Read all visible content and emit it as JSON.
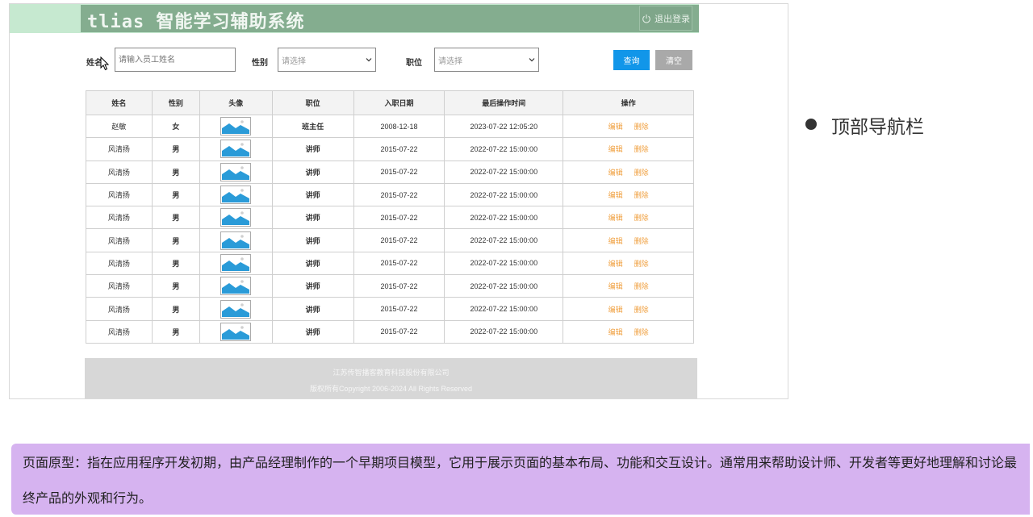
{
  "header": {
    "brand": "tlias 智能学习辅助系统",
    "logout_label": "退出登录"
  },
  "filters": {
    "name_label": "姓名",
    "name_placeholder": "请输入员工姓名",
    "gender_label": "性别",
    "gender_value": "请选择",
    "job_label": "职位",
    "job_value": "请选择",
    "query_label": "查询",
    "clear_label": "清空"
  },
  "table": {
    "columns": [
      "姓名",
      "性别",
      "头像",
      "职位",
      "入职日期",
      "最后操作时间",
      "操作"
    ],
    "edit_label": "编辑",
    "delete_label": "删除",
    "rows": [
      {
        "name": "赵敏",
        "gender": "女",
        "job": "班主任",
        "entry_date": "2008-12-18",
        "update_time": "2023-07-22 12:05:20"
      },
      {
        "name": "风清扬",
        "gender": "男",
        "job": "讲师",
        "entry_date": "2015-07-22",
        "update_time": "2022-07-22 15:00:00"
      },
      {
        "name": "风清扬",
        "gender": "男",
        "job": "讲师",
        "entry_date": "2015-07-22",
        "update_time": "2022-07-22 15:00:00"
      },
      {
        "name": "风清扬",
        "gender": "男",
        "job": "讲师",
        "entry_date": "2015-07-22",
        "update_time": "2022-07-22 15:00:00"
      },
      {
        "name": "风清扬",
        "gender": "男",
        "job": "讲师",
        "entry_date": "2015-07-22",
        "update_time": "2022-07-22 15:00:00"
      },
      {
        "name": "风清扬",
        "gender": "男",
        "job": "讲师",
        "entry_date": "2015-07-22",
        "update_time": "2022-07-22 15:00:00"
      },
      {
        "name": "风清扬",
        "gender": "男",
        "job": "讲师",
        "entry_date": "2015-07-22",
        "update_time": "2022-07-22 15:00:00"
      },
      {
        "name": "风清扬",
        "gender": "男",
        "job": "讲师",
        "entry_date": "2015-07-22",
        "update_time": "2022-07-22 15:00:00"
      },
      {
        "name": "风清扬",
        "gender": "男",
        "job": "讲师",
        "entry_date": "2015-07-22",
        "update_time": "2022-07-22 15:00:00"
      },
      {
        "name": "风清扬",
        "gender": "男",
        "job": "讲师",
        "entry_date": "2015-07-22",
        "update_time": "2022-07-22 15:00:00"
      }
    ]
  },
  "footer": {
    "company": "江苏传智播客教育科技股份有限公司",
    "copyright": "版权所有Copyright 2006-2024  All Rights Reserved"
  },
  "side": {
    "bullet_text": "顶部导航栏"
  },
  "note": {
    "text": "页面原型：指在应用程序开发初期，由产品经理制作的一个早期项目模型，它用于展示页面的基本布局、功能和交互设计。通常用来帮助设计师、开发者等更好地理解和讨论最终产品的外观和行为。"
  },
  "colors": {
    "header_bg": "#84ad8f",
    "header_outer": "#c6e9d0",
    "query_button": "#1196e9",
    "clear_button": "#a9a9a9",
    "action_link": "#f0a040",
    "note_bg": "#d6b3f0"
  },
  "icons": {
    "logout": "power-icon",
    "avatar": "image-placeholder-icon",
    "select_arrow": "chevron-down-icon",
    "mouse": "cursor-icon"
  }
}
